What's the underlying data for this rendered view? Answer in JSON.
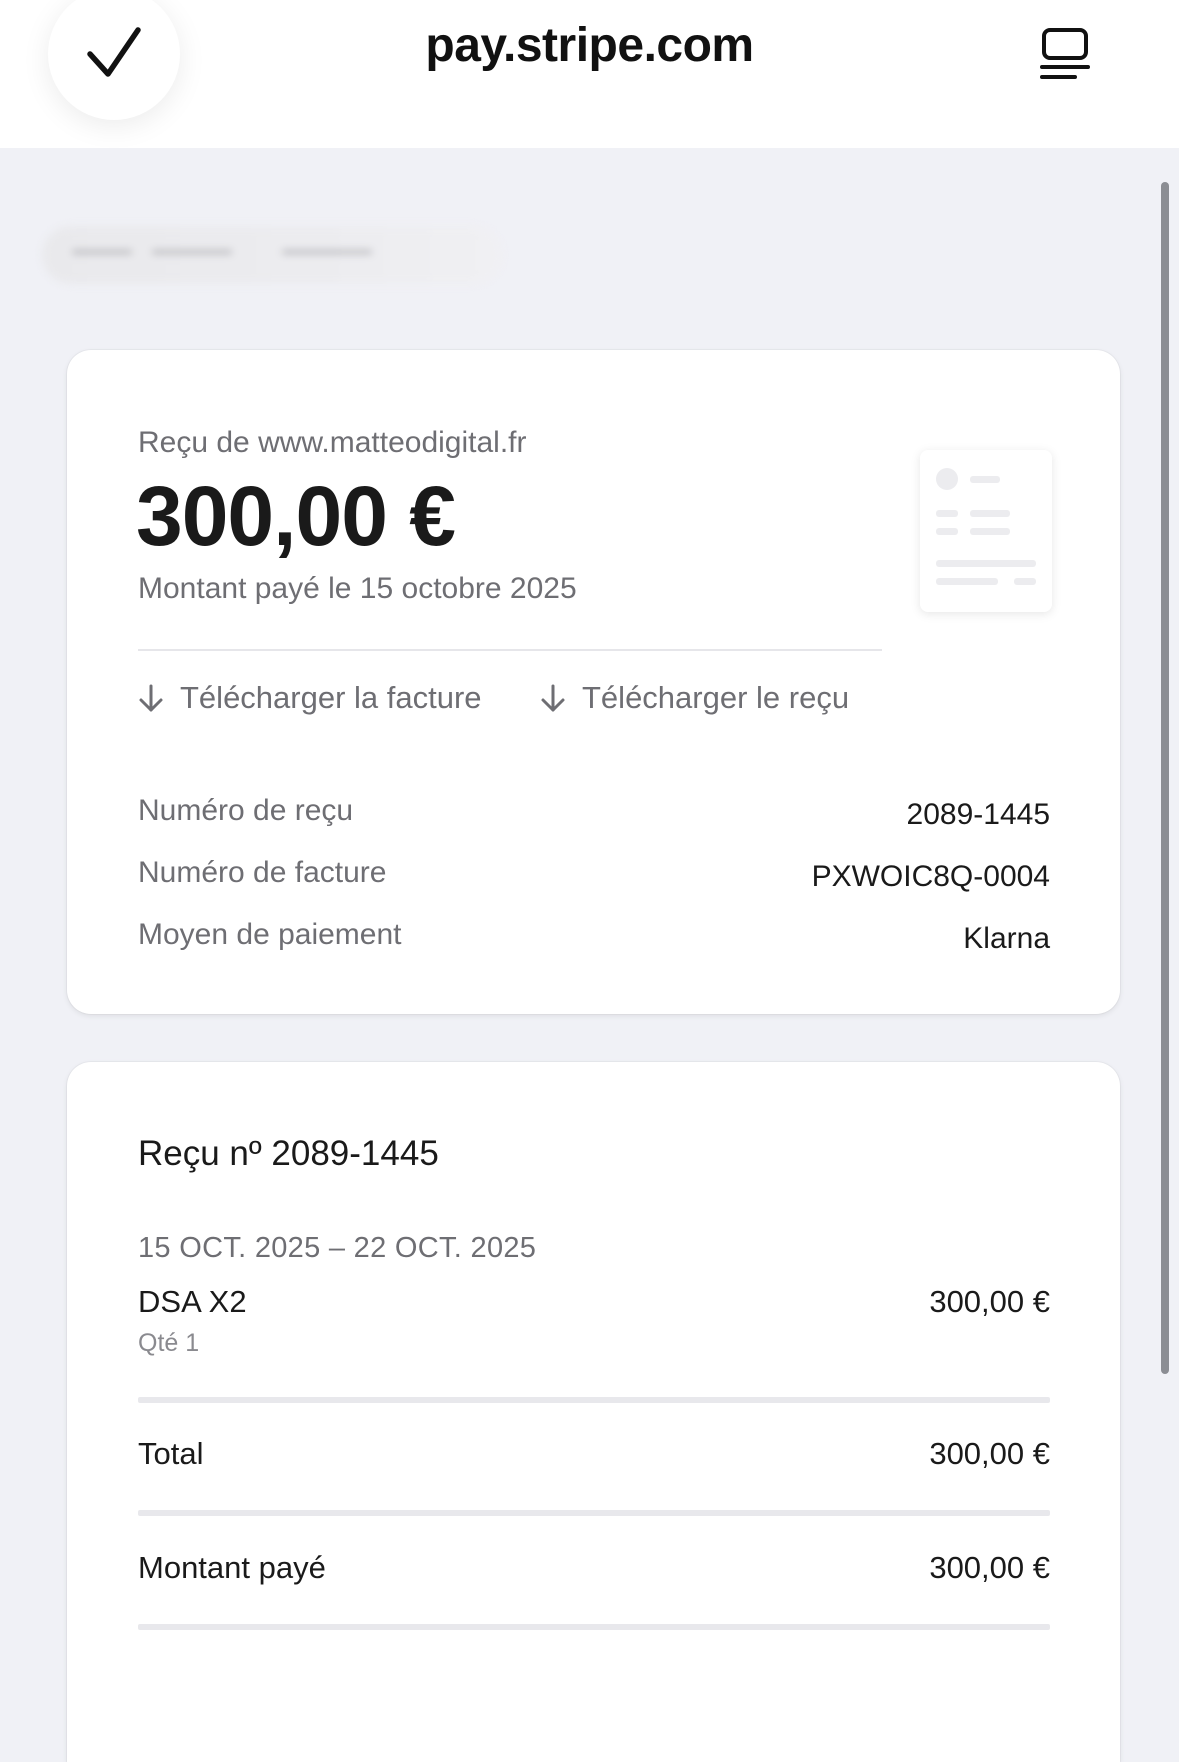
{
  "browser": {
    "site_title": "pay.stripe.com"
  },
  "receipt_summary": {
    "from_label": "Reçu de www.matteodigital.fr",
    "amount": "300,00 €",
    "paid_on": "Montant payé le 15 octobre 2025",
    "download_invoice": "Télécharger la facture",
    "download_receipt": "Télécharger le reçu",
    "details": [
      {
        "label": "Numéro de reçu",
        "value": "2089-1445"
      },
      {
        "label": "Numéro de facture",
        "value": "PXWOIC8Q-0004"
      },
      {
        "label": "Moyen de paiement",
        "value": "Klarna"
      }
    ]
  },
  "receipt_detail": {
    "title": "Reçu nº 2089-1445",
    "period": "15 OCT. 2025 – 22 OCT. 2025",
    "item": {
      "name": "DSA X2",
      "qty": "Qté 1",
      "price": "300,00 €"
    },
    "total_label": "Total",
    "total_value": "300,00 €",
    "paid_label": "Montant payé",
    "paid_value": "300,00 €"
  },
  "icons": {
    "done": "checkmark-icon",
    "reader": "reader-mode-icon",
    "download": "arrow-down-icon",
    "receipt_illustration": "receipt-illustration-icon"
  }
}
